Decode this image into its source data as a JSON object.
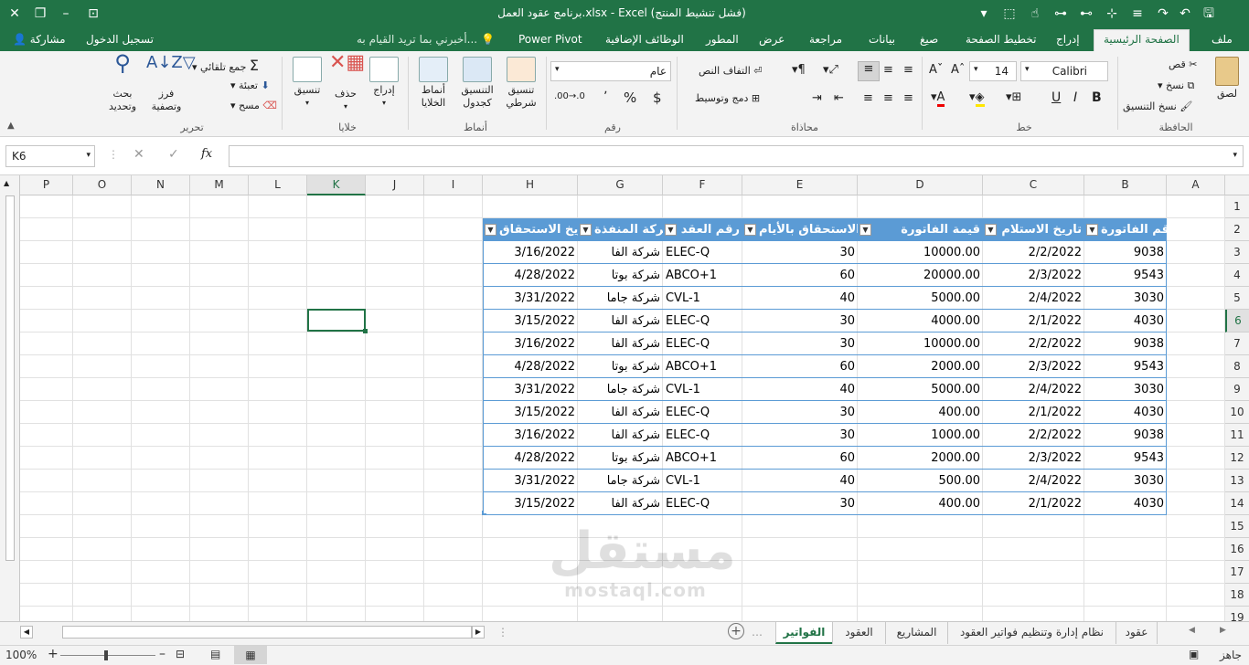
{
  "window": {
    "title": "برنامج عقود العمل.xlsx - Excel (فشل تنشيط المنتج)",
    "colors": {
      "brand": "#217346",
      "table_header": "#5b9bd5",
      "table_border": "#5b9bd5"
    }
  },
  "tabs": {
    "file": "ملف",
    "home": "الصفحة الرئيسية",
    "insert": "إدراج",
    "page_layout": "تخطيط الصفحة",
    "formulas": "صيغ",
    "data": "بيانات",
    "review": "مراجعة",
    "view": "عرض",
    "developer": "المطور",
    "addins": "الوظائف الإضافية",
    "power_pivot": "Power Pivot",
    "tell_me": "أخبرني بما تريد القيام به...",
    "sign_in": "تسجيل الدخول",
    "share": "مشاركة"
  },
  "ribbon": {
    "clipboard": {
      "label": "الحافظة",
      "paste": "لصق",
      "cut": "قص",
      "copy": "نسخ",
      "format_painter": "نسخ التنسيق"
    },
    "font": {
      "label": "خط",
      "name": "Calibri",
      "size": "14",
      "bold": "B",
      "italic": "I",
      "underline": "U"
    },
    "alignment": {
      "label": "محاذاة",
      "wrap_text": "التفاف النص",
      "merge_center": "دمج وتوسيط"
    },
    "number": {
      "label": "رقم",
      "format": "عام",
      "currency": "$",
      "percent": "%",
      "comma": "٬"
    },
    "styles": {
      "label": "أنماط",
      "conditional": "تنسيق شرطي",
      "format_table": "التنسيق كجدول",
      "cell_styles": "أنماط الخلايا"
    },
    "cells": {
      "label": "خلايا",
      "insert": "إدراج",
      "delete": "حذف",
      "format": "تنسيق"
    },
    "editing": {
      "label": "تحرير",
      "autosum": "جمع تلقائي",
      "fill": "تعبئة",
      "clear": "مسح",
      "sort": "فرز وتصفية",
      "find": "بحث وتحديد"
    }
  },
  "formula_bar": {
    "name_box": "K6",
    "fx": "fx",
    "value": ""
  },
  "columns": [
    "A",
    "B",
    "C",
    "D",
    "E",
    "F",
    "G",
    "H",
    "I",
    "J",
    "K",
    "L",
    "M",
    "N",
    "O",
    "P"
  ],
  "rows": [
    "1",
    "2",
    "3",
    "4",
    "5",
    "6",
    "7",
    "8",
    "9",
    "10",
    "11",
    "12",
    "13",
    "14",
    "15",
    "16",
    "17",
    "18",
    "19"
  ],
  "selected": {
    "column": "K",
    "row": "6"
  },
  "table": {
    "headers": [
      "رقم الفاتورة",
      "تاريخ الاستلام",
      "قيمة الفاتورة",
      "مدة الاستحقاق بالأيام",
      "رقم العقد",
      "الشركة المنفذة",
      "تاريخ الاستحقاق"
    ],
    "rows": [
      [
        "9038",
        "2/2/2022",
        "10000.00",
        "30",
        "ELEC-Q",
        "شركة الفا",
        "3/16/2022"
      ],
      [
        "9543",
        "2/3/2022",
        "20000.00",
        "60",
        "ABCO+1",
        "شركة بوتا",
        "4/28/2022"
      ],
      [
        "3030",
        "2/4/2022",
        "5000.00",
        "40",
        "CVL-1",
        "شركة جاما",
        "3/31/2022"
      ],
      [
        "4030",
        "2/1/2022",
        "4000.00",
        "30",
        "ELEC-Q",
        "شركة الفا",
        "3/15/2022"
      ],
      [
        "9038",
        "2/2/2022",
        "10000.00",
        "30",
        "ELEC-Q",
        "شركة الفا",
        "3/16/2022"
      ],
      [
        "9543",
        "2/3/2022",
        "2000.00",
        "60",
        "ABCO+1",
        "شركة بوتا",
        "4/28/2022"
      ],
      [
        "3030",
        "2/4/2022",
        "5000.00",
        "40",
        "CVL-1",
        "شركة جاما",
        "3/31/2022"
      ],
      [
        "4030",
        "2/1/2022",
        "400.00",
        "30",
        "ELEC-Q",
        "شركة الفا",
        "3/15/2022"
      ],
      [
        "9038",
        "2/2/2022",
        "1000.00",
        "30",
        "ELEC-Q",
        "شركة الفا",
        "3/16/2022"
      ],
      [
        "9543",
        "2/3/2022",
        "2000.00",
        "60",
        "ABCO+1",
        "شركة بوتا",
        "4/28/2022"
      ],
      [
        "3030",
        "2/4/2022",
        "500.00",
        "40",
        "CVL-1",
        "شركة جاما",
        "3/31/2022"
      ],
      [
        "4030",
        "2/1/2022",
        "400.00",
        "30",
        "ELEC-Q",
        "شركة الفا",
        "3/15/2022"
      ]
    ]
  },
  "sheets": [
    "عقود",
    "نظام إدارة وتنظيم فواتير العقود",
    "المشاريع",
    "العقود",
    "الفواتير"
  ],
  "active_sheet": "الفواتير",
  "status": {
    "ready": "جاهز",
    "zoom": "100%"
  },
  "watermark": {
    "text": "مستقل",
    "sub": "mostaql.com"
  }
}
